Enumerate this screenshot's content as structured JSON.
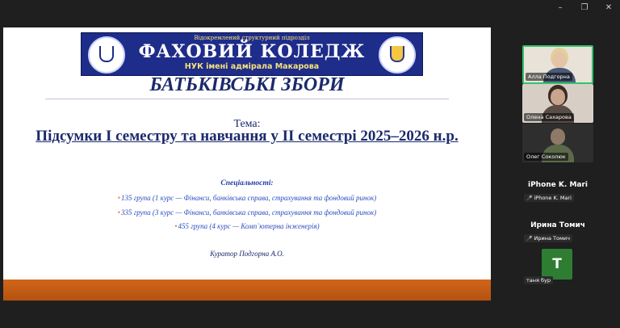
{
  "window": {
    "minimize_icon": "–",
    "restore_icon": "❐",
    "close_icon": "✕"
  },
  "slide": {
    "banner_top": "Відокремлений структурний підрозділ",
    "banner_title": "ФАХОВИЙ КОЛЕДЖ",
    "banner_sub": "НУК імені адмірала Макарова",
    "meeting_title": "БАТЬКІВСЬКІ ЗБОРИ",
    "topic_label": "Тема:",
    "topic": "Підсумки І семестру та навчання у ІІ семестрі 2025–2026 н.р.",
    "specialties_title": "Спеціальності:",
    "groups": [
      "135 група (1 курс — Фінанси, банківська справа, страхування та фондовий ринок)",
      "335 група (3 курс — Фінанси, банківська справа, страхування та фондовий ринок)",
      "455 група (4 курс — Комп`ютерна інженерія)"
    ],
    "bullet": "•",
    "curator": "Куратор Подгорна А.О.",
    "colors": {
      "title": "#1b2a6b",
      "banner": "#1e2c8a",
      "footer": "#c65d16",
      "bullet": "#e07a1f"
    }
  },
  "participants": [
    {
      "name": "Алла Подгорна",
      "type": "video",
      "active": true
    },
    {
      "name": "Олена Сахарова",
      "type": "video"
    },
    {
      "name": "Олег Соколюк",
      "type": "video"
    },
    {
      "big_name": "iPhone K. Mari",
      "name": "iPhone K. Mari",
      "type": "no-video",
      "mic_icon": "🎤"
    },
    {
      "big_name": "Ирина Томич",
      "name": "Ирина Томич",
      "type": "no-video",
      "mic_icon": "🎤"
    },
    {
      "avatar_letter": "T",
      "name": "таня бур",
      "type": "avatar"
    }
  ]
}
